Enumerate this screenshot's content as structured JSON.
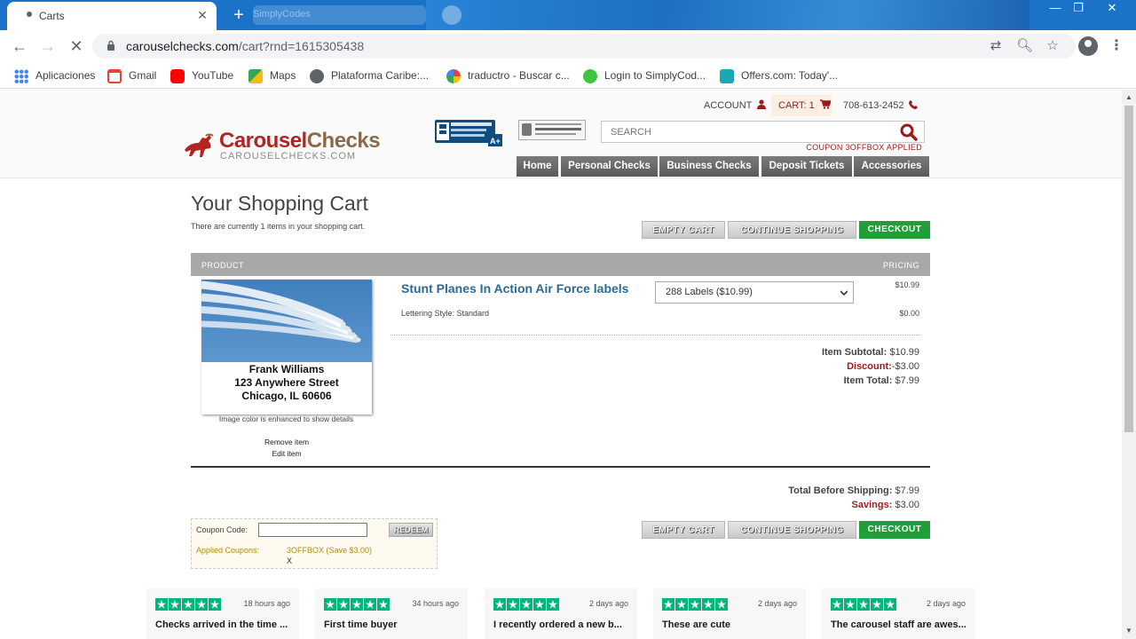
{
  "browser": {
    "tab_title": "Carts",
    "ghost_tab_title": "SimplyCodes",
    "url_host": "carouselchecks.com",
    "url_path": "/cart?rnd=1615305438"
  },
  "bookmarks": [
    {
      "label": "Aplicaciones",
      "icon": "apps-grid-icon",
      "color": "#4285f4"
    },
    {
      "label": "Gmail",
      "icon": "gmail-icon",
      "color": "#ea4335"
    },
    {
      "label": "YouTube",
      "icon": "youtube-icon",
      "color": "#ff0000"
    },
    {
      "label": "Maps",
      "icon": "maps-icon",
      "color": "#34a853"
    },
    {
      "label": "Plataforma Caribe:...",
      "icon": "globe-icon",
      "color": "#5f6368"
    },
    {
      "label": "traductro - Buscar c...",
      "icon": "google-icon",
      "color": "#4285f4"
    },
    {
      "label": "Login to SimplyCod...",
      "icon": "simplycodes-icon",
      "color": "#3cc640"
    },
    {
      "label": "Offers.com: Today'...",
      "icon": "offers-icon",
      "color": "#1ba7b6"
    }
  ],
  "site": {
    "account_label": "ACCOUNT",
    "cart_label": "CART: 1",
    "phone": "708-613-2452",
    "logo_main_a": "Carousel",
    "logo_main_b": "Checks",
    "logo_sub": "CAROUSELCHECKS.COM",
    "search_placeholder": "SEARCH",
    "coupon_applied_note": "COUPON 3OFFBOX APPLIED",
    "nav": [
      "Home",
      "Personal Checks",
      "Business Checks",
      "Deposit Tickets",
      "Accessories"
    ],
    "accent_red": "#b3241f",
    "checkout_green": "#1f9e3a"
  },
  "cart": {
    "title": "Your Shopping Cart",
    "count_text": "There are currently 1 items in your shopping cart.",
    "buttons": {
      "empty": "EMPTY CART",
      "continue": "CONTINUE SHOPPING",
      "checkout": "CHECKOUT"
    },
    "header_product": "PRODUCT",
    "header_pricing": "PRICING",
    "item": {
      "image_lines": [
        "Frank Williams",
        "123 Anywhere Street",
        "Chicago, IL 60606"
      ],
      "image_note": "Image color is enhanced to show details",
      "remove": "Remove item",
      "edit": "Edit item",
      "name": "Stunt Planes In Action Air Force labels",
      "option_selected": "288 Labels ($10.99)",
      "price": "$10.99",
      "lettering": "Lettering Style: Standard",
      "lettering_price": "$0.00",
      "subtotal_label": "Item Subtotal:",
      "subtotal": "$10.99",
      "discount_label": "Discount:",
      "discount": "-$3.00",
      "total_label": "Item Total:",
      "total": "$7.99"
    },
    "before_shipping_label": "Total Before Shipping:",
    "before_shipping": "$7.99",
    "savings_label": "Savings:",
    "savings": "$3.00",
    "coupon": {
      "label": "Coupon Code:",
      "value": "",
      "redeem": "REDEEM",
      "applied_label": "Applied Coupons:",
      "applied_value": "3OFFBOX (Save $3.00)",
      "remove_x": "X"
    }
  },
  "reviews": [
    {
      "ago": "18 hours ago",
      "text": "Checks arrived in the time ..."
    },
    {
      "ago": "34 hours ago",
      "text": "First time buyer"
    },
    {
      "ago": "2 days ago",
      "text": "I recently ordered a new b..."
    },
    {
      "ago": "2 days ago",
      "text": "These are cute"
    },
    {
      "ago": "2 days ago",
      "text": "The carousel staff are awes..."
    }
  ]
}
